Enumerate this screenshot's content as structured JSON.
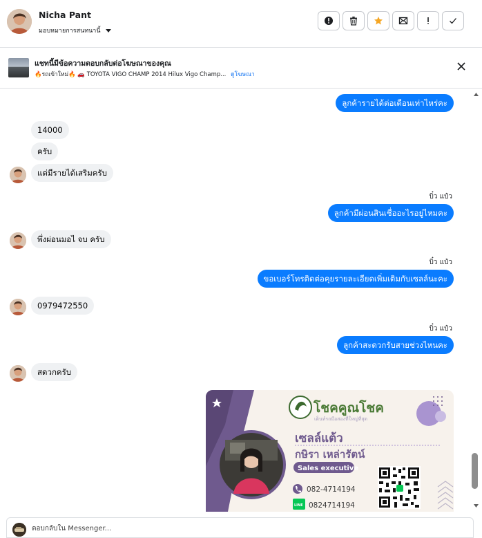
{
  "header": {
    "contact_name": "Nicha Pant",
    "assign_label": "มอบหมายการสนทนานี้",
    "actions": [
      {
        "icon": "alert-circle-icon"
      },
      {
        "icon": "trash-icon"
      },
      {
        "icon": "star-icon",
        "color": "#f5a623"
      },
      {
        "icon": "mark-unread-icon"
      },
      {
        "icon": "exclamation-icon"
      },
      {
        "icon": "checkmark-icon"
      }
    ]
  },
  "ad": {
    "title": "แชทนี้มีข้อความตอบกลับต่อโฆษณาของคุณ",
    "subtitle": "🔥รถเข้าใหม่🔥 🚗 TOYOTA VIGO CHAMP 2014 Hilux Vigo Champ...",
    "link": "ดูโฆษณา"
  },
  "messages": {
    "m1": "ลูกค้ารายได้ต่อเดือนเท่าไหร่คะ",
    "m2": "14000",
    "m3": "ครับ",
    "m4": "แต่มีรายได้เสริมครับ",
    "s1": "บิ๋ว แป๋ว",
    "m5": "ลูกค้ามีผ่อนสินเชื่ออะไรอยู่ไหมคะ",
    "m6": "พึ่งผ่อนมอไ จบ ครับ",
    "s2": "บิ๋ว แป๋ว",
    "m7": "ขอเบอร์โทรติดต่อคุยรายละเอียดเพิ่มเติมกับเซลล์นะคะ",
    "m8": "0979472550",
    "s3": "บิ๋ว แป๋ว",
    "m9": "ลูกค้าสะดวกรับสายช่วงไหนคะ",
    "m10": "สดวกครับ"
  },
  "card": {
    "brand": "โชคคูณโชค",
    "tagline": "เต็นท์รถมือสองที่ใหญ่ที่สุด",
    "name_nick": "เซลล์แต้ว",
    "name_full": "กษิรา เหล่ารัตน์",
    "role": "Sales executive",
    "phone": "082-4714194",
    "line": "0824714194",
    "line_badge": "LINE",
    "colors": {
      "purple": "#6f5a8e",
      "green": "#3c6a2f",
      "lavender": "#a994d0"
    }
  },
  "reply": {
    "placeholder": "ตอบกลับใน Messenger..."
  },
  "colors": {
    "outgoing": "#0a7cff",
    "incoming": "#eff1f3"
  }
}
